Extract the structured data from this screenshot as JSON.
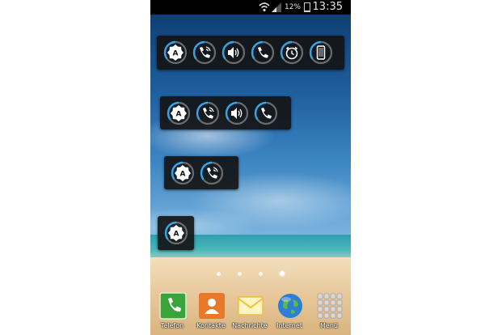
{
  "status_bar": {
    "battery_percent": "12%",
    "time": "13:35",
    "battery_level": 0.12,
    "icons": [
      "wifi-icon",
      "signal-icon",
      "battery-icon"
    ]
  },
  "widgets": [
    {
      "toggles": [
        "auto-brightness-icon",
        "phone-ring-icon",
        "volume-icon",
        "phone-icon",
        "alarm-icon",
        "phone-device-icon"
      ]
    },
    {
      "toggles": [
        "auto-brightness-icon",
        "phone-ring-icon",
        "volume-icon",
        "phone-icon"
      ]
    },
    {
      "toggles": [
        "auto-brightness-icon",
        "phone-ring-icon"
      ]
    },
    {
      "toggles": [
        "auto-brightness-icon"
      ]
    }
  ],
  "brightness_glyph": "A",
  "home_pages": {
    "count": 4,
    "current": 4
  },
  "dock": {
    "apps": [
      {
        "label": "Telefon",
        "icon": "phone-icon",
        "color": "#3aa33a"
      },
      {
        "label": "Kontakte",
        "icon": "contacts-icon",
        "color": "#e8782a"
      },
      {
        "label": "Nachrichte",
        "icon": "messages-icon",
        "color": "#f1c232"
      },
      {
        "label": "Internet",
        "icon": "globe-icon",
        "color": "#2d7fd3"
      },
      {
        "label": "Menü",
        "icon": "app-grid-icon",
        "color": "#d9d9d9"
      }
    ]
  },
  "colors": {
    "accent": "#2fa6e6",
    "widget_bg": "#141416"
  }
}
